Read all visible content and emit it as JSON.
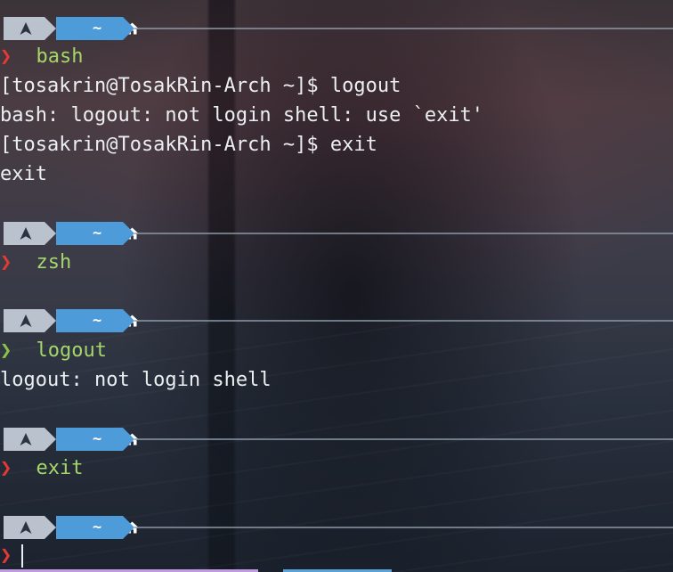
{
  "prompt": {
    "os_icon": "arch-linux-icon",
    "dir_icon": "home-icon",
    "dir_label": "~",
    "colors": {
      "os_segment": "#b9c2cd",
      "dir_segment": "#4e9bd9",
      "chevron_error": "#e53935",
      "chevron_ok": "#8bc34a",
      "command": "#a5d66b"
    }
  },
  "blocks": [
    {
      "status": "error",
      "chevron": "❯",
      "command": "bash",
      "output": [
        "[tosakrin@TosakRin-Arch ~]$ logout",
        "bash: logout: not login shell: use `exit'",
        "[tosakrin@TosakRin-Arch ~]$ exit",
        "exit"
      ]
    },
    {
      "status": "error",
      "chevron": "❯",
      "command": "zsh",
      "output": []
    },
    {
      "status": "ok",
      "chevron": "❯",
      "command": "logout",
      "output": [
        "logout: not login shell"
      ]
    },
    {
      "status": "error",
      "chevron": "❯",
      "command": "exit",
      "output": []
    },
    {
      "status": "error",
      "chevron": "❯",
      "command": "",
      "output": []
    }
  ]
}
